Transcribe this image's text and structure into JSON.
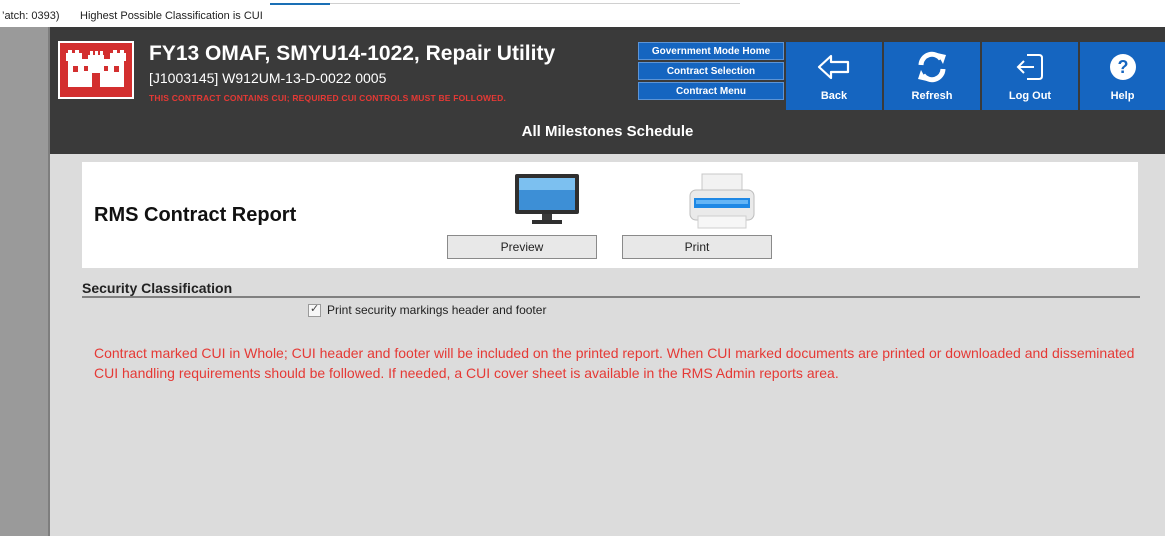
{
  "status_strip": {
    "patch": "’atch: 0393)",
    "classification": "Highest Possible Classification is CUI"
  },
  "header": {
    "logo": "usace-castle-logo",
    "title": "FY13 OMAF, SMYU14-1022, Repair Utility",
    "subtitle": "[J1003145] W912UM-13-D-0022  0005",
    "warning": "THIS CONTRACT CONTAINS CUI; REQUIRED CUI CONTROLS MUST BE FOLLOWED.",
    "nav": {
      "home": "Government Mode Home",
      "selection": "Contract Selection",
      "menu": "Contract Menu"
    },
    "tiles": {
      "back": "Back",
      "refresh": "Refresh",
      "logout": "Log Out",
      "help": "Help"
    }
  },
  "page_title": "All Milestones Schedule",
  "report": {
    "title": "RMS Contract Report",
    "preview_label": "Preview",
    "print_label": "Print"
  },
  "security": {
    "section_title": "Security Classification",
    "checkbox_label": "Print security markings header and footer",
    "checked": true,
    "notice": "Contract marked CUI in Whole; CUI header and footer will be included on the printed report. When CUI marked documents are printed or downloaded and disseminated CUI handling requirements should be followed. If needed, a CUI cover sheet is available in the RMS Admin reports area."
  },
  "colors": {
    "accent_blue": "#1565c0",
    "warning_red": "#e53935",
    "header_dark": "#3a3a3a",
    "content_gray": "#dcdcdc"
  }
}
